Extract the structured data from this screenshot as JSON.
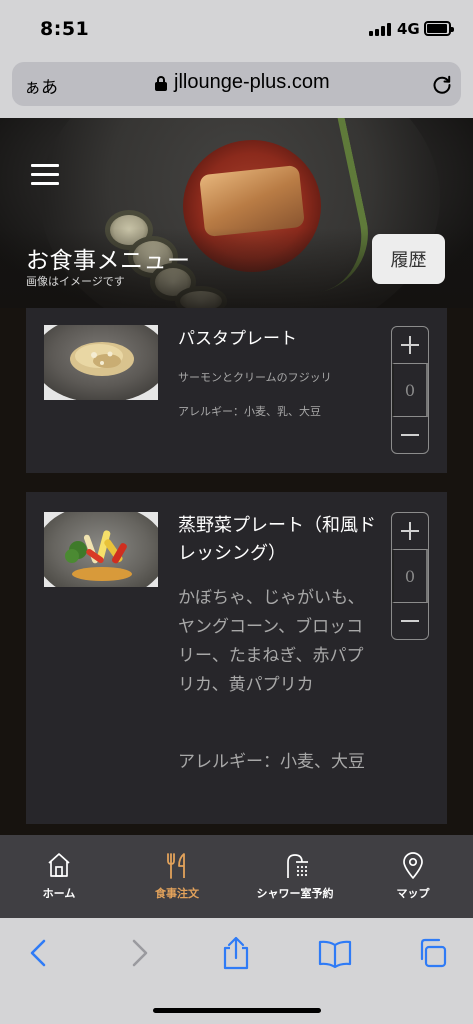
{
  "status_bar": {
    "time": "8:51",
    "network": "4G"
  },
  "browser": {
    "text_size_label": "ぁあ",
    "domain": "jllounge-plus.com"
  },
  "header": {
    "title": "お食事メニュー",
    "subtitle": "画像はイメージです",
    "history_button": "履歴"
  },
  "menu": {
    "items": [
      {
        "name": "パスタプレート",
        "description": "サーモンとクリームのフジッリ",
        "allergy": "アレルギー：小麦、乳、大豆",
        "quantity": "0"
      },
      {
        "name": "蒸野菜プレート（和風ドレッシング）",
        "description": "かぼちゃ、じゃがいも、ヤングコーン、ブロッコリー、たまねぎ、赤パプリカ、黄パプリカ",
        "allergy": "アレルギー：小麦、大豆",
        "quantity": "0"
      }
    ]
  },
  "tabs": [
    {
      "label": "ホーム",
      "icon": "home-icon"
    },
    {
      "label": "食事注文",
      "icon": "fork-knife-icon",
      "active": true
    },
    {
      "label": "シャワー室予約",
      "icon": "shower-icon"
    },
    {
      "label": "マップ",
      "icon": "map-pin-icon"
    }
  ],
  "colors": {
    "accent": "#e2a25b",
    "safari_blue": "#2f7bf6",
    "card": "#27262a",
    "tabbar": "#403f43"
  }
}
